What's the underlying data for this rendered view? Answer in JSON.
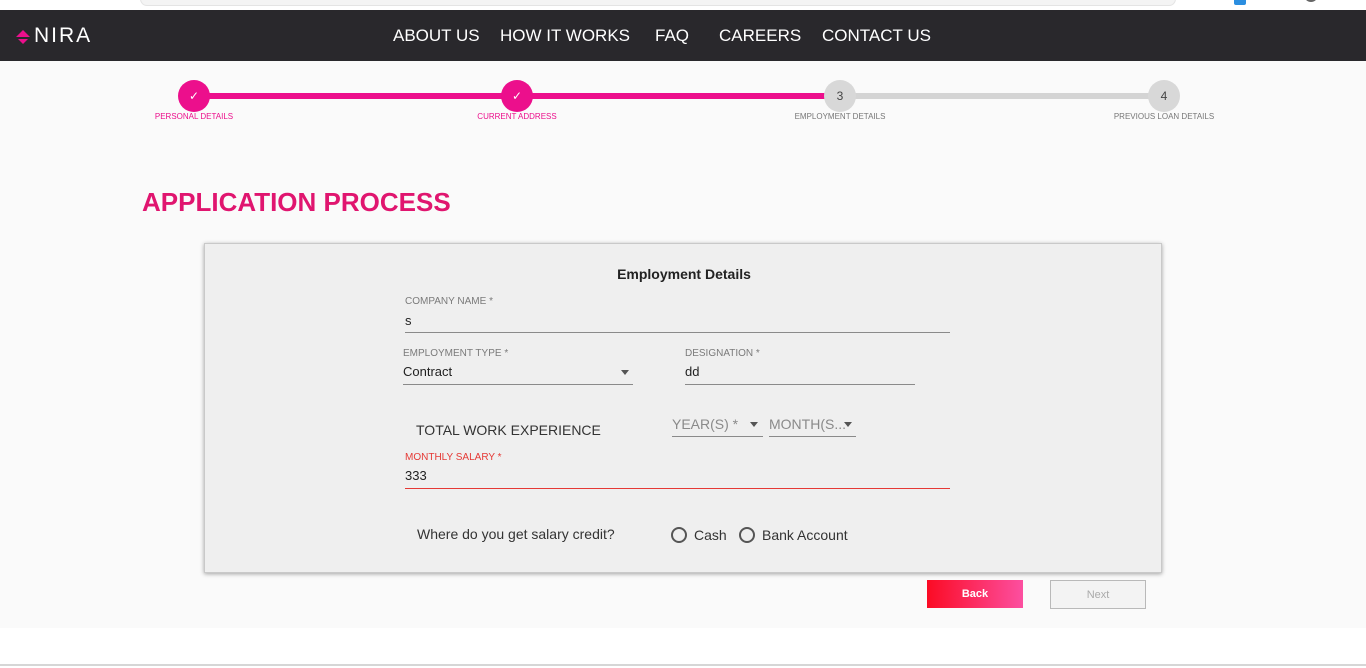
{
  "brand": {
    "logo_text": "NIRA",
    "accent": "#ec0f8c"
  },
  "nav": {
    "items": [
      {
        "label": "ABOUT US"
      },
      {
        "label": "HOW IT WORKS"
      },
      {
        "label": "FAQ"
      },
      {
        "label": "CAREERS"
      },
      {
        "label": "CONTACT US"
      }
    ]
  },
  "stepper": {
    "steps": [
      {
        "label": "PERSONAL DETAILS",
        "status": "done",
        "marker": "✓"
      },
      {
        "label": "CURRENT ADDRESS",
        "status": "done",
        "marker": "✓"
      },
      {
        "label": "EMPLOYMENT DETAILS",
        "status": "pending",
        "marker": "3"
      },
      {
        "label": "PREVIOUS LOAN DETAILS",
        "status": "pending",
        "marker": "4"
      }
    ]
  },
  "page": {
    "title": "APPLICATION PROCESS"
  },
  "form": {
    "title": "Employment Details",
    "company_name": {
      "label": "COMPANY NAME  *",
      "value": "s"
    },
    "employment_type": {
      "label": "EMPLOYMENT TYPE  *",
      "value": "Contract"
    },
    "designation": {
      "label": "DESIGNATION  *",
      "value": "dd"
    },
    "total_work_experience": {
      "label": "TOTAL WORK EXPERIENCE",
      "years_placeholder": "YEAR(S)  *",
      "months_placeholder": "MONTH(S..."
    },
    "monthly_salary": {
      "label": "MONTHLY SALARY  *",
      "value": "333"
    },
    "salary_credit": {
      "question": "Where do you get salary credit?",
      "options": [
        {
          "label": "Cash"
        },
        {
          "label": "Bank Account"
        }
      ]
    }
  },
  "actions": {
    "back_label": "Back",
    "next_label": "Next"
  }
}
